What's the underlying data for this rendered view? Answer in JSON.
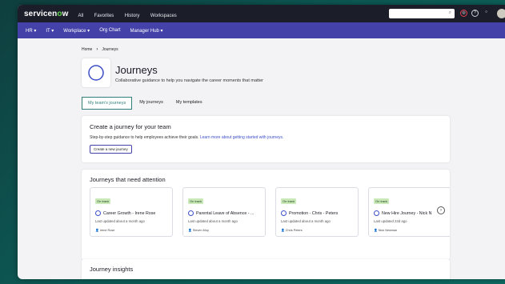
{
  "topbar": {
    "logo_pre": "servicen",
    "logo_o": "o",
    "logo_post": "w",
    "nav": [
      "All",
      "Favorites",
      "History",
      "Workspaces"
    ]
  },
  "subnav": [
    "HR ▾",
    "IT ▾",
    "Workplace ▾",
    "Org Chart",
    "Manager Hub ▾"
  ],
  "breadcrumb": {
    "home": "Home",
    "current": "Journeys"
  },
  "page": {
    "title": "Journeys",
    "subtitle": "Collaborative guidance to help you navigate the career moments that matter"
  },
  "tabs": [
    "My team's journeys",
    "My journeys",
    "My templates"
  ],
  "create_card": {
    "title": "Create a journey for your team",
    "desc": "Step-by-step guidance to help employees achieve their goals.",
    "link": "Learn more about getting started with journeys.",
    "button": "Create a new journey"
  },
  "attention": {
    "title": "Journeys that need attention",
    "cards": [
      {
        "status": "On track",
        "title": "Career Growth - Irene Rose",
        "updated": "Last updated about a month ago",
        "owner": "Irene Rose"
      },
      {
        "status": "On track",
        "title": "Parental Leave of Absence - ...",
        "updated": "Last updated about a month ago",
        "owner": "Steven Moy"
      },
      {
        "status": "On track",
        "title": "Promotion - Chris - Peters",
        "updated": "Last updated about a month ago",
        "owner": "Chris Peters"
      },
      {
        "status": "On track",
        "title": "New Hire Journey - Nick N",
        "updated": "Last updated 23d ago",
        "owner": "Nick Newman"
      }
    ]
  },
  "insights": {
    "title": "Journey insights"
  },
  "colors": {
    "topbar": "#1b1e29",
    "subnav": "#4442a8",
    "accent": "#2f7f7a",
    "badge": "#c9e9b8"
  }
}
